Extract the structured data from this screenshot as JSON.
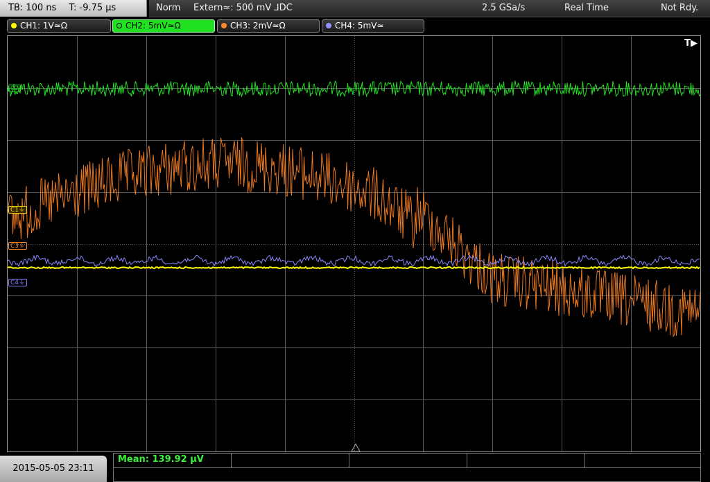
{
  "header": {
    "timebase": "TB: 100 ns",
    "trigger_time": "T: -9.75 µs",
    "mode": "Norm",
    "trigger_source": "Extern≃: 500 mV ⅃DC",
    "sample_rate": "2.5 GSa/s",
    "acq_mode": "Real Time",
    "status": "Not Rdy."
  },
  "channels": [
    {
      "id": "ch1",
      "label": "CH1: 1V≃Ω",
      "color": "#ffff00",
      "active": false
    },
    {
      "id": "ch2",
      "label": "CH2: 5mV≃Ω",
      "color": "#22e022",
      "active": true
    },
    {
      "id": "ch3",
      "label": "CH3: 2mV≃Ω",
      "color": "#ff8a2a",
      "active": false
    },
    {
      "id": "ch4",
      "label": "CH4: 5mV≃",
      "color": "#9090ff",
      "active": false
    }
  ],
  "screen": {
    "trigger_indicator": "T▶",
    "markers": [
      {
        "id": "c1",
        "label": "C1⏚",
        "color": "#ffd000"
      },
      {
        "id": "c2",
        "label": "C2",
        "color": "#22e022"
      },
      {
        "id": "c3",
        "label": "C3⏚",
        "color": "#ff8a2a"
      },
      {
        "id": "c4",
        "label": "C4⏚",
        "color": "#8080ff"
      }
    ]
  },
  "footer": {
    "datetime": "2015-05-05 23:11",
    "measurement": "Mean: 139.92 µV"
  },
  "colors": {
    "ch1": "#ffff00",
    "ch2": "#22e022",
    "ch3": "#e87820",
    "ch4": "#8888ff",
    "grid": "#5a5a5a"
  }
}
